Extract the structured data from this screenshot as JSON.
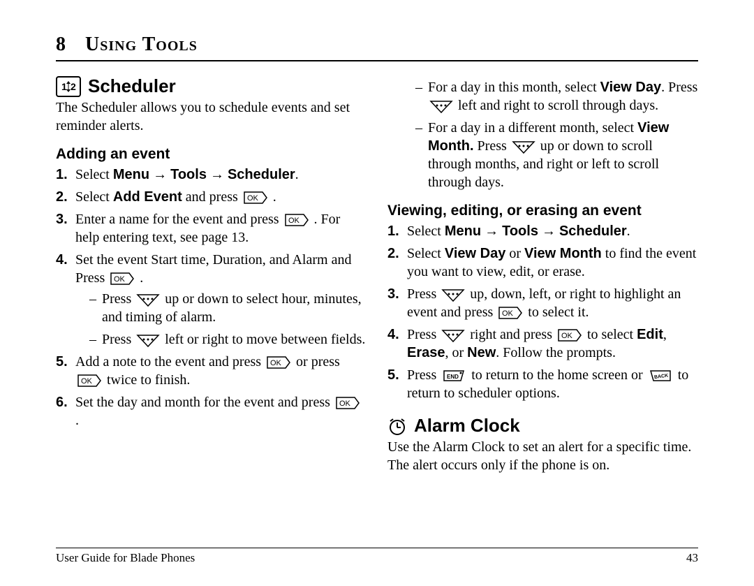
{
  "chapter": {
    "number": "8",
    "title": "Using Tools"
  },
  "col1": {
    "scheduler": {
      "heading": "Scheduler",
      "intro": "The Scheduler allows you to schedule events and set reminder alerts.",
      "adding": {
        "heading": "Adding an event",
        "step1_a": "Select ",
        "step1_menu": "Menu",
        "step1_arrow1": " → ",
        "step1_tools": "Tools",
        "step1_arrow2": " → ",
        "step1_sched": "Scheduler",
        "step1_end": ".",
        "step2_a": "Select ",
        "step2_b": "Add Event",
        "step2_c": " and press ",
        "step2_d": " .",
        "step3_a": "Enter a name for the event and press ",
        "step3_b": " . For help entering text, see page 13.",
        "step4_a": "Set the event Start time, Duration, and Alarm and Press ",
        "step4_b": " .",
        "step4_sub1_a": "Press ",
        "step4_sub1_b": " up or down to select hour, minutes, and timing of alarm.",
        "step4_sub2_a": "Press ",
        "step4_sub2_b": " left or right to move between fields.",
        "step5_a": "Add a note to the event and press ",
        "step5_b": "  or press ",
        "step5_c": " twice to finish.",
        "step6_a": "Set the day and month for the event and press ",
        "step6_b": " ."
      }
    }
  },
  "col2": {
    "cont": {
      "bullet1_a": "For a day in this month, select ",
      "bullet1_b": "View Day",
      "bullet1_c": ". Press ",
      "bullet1_d": " left and right to scroll through days.",
      "bullet2_a": "For a day in a different month, select ",
      "bullet2_b": "View Month.",
      "bullet2_c": " Press ",
      "bullet2_d": " up or down to scroll through months, and right or left to scroll through days."
    },
    "viewing": {
      "heading": "Viewing, editing, or erasing an event",
      "step1_a": "Select ",
      "step1_menu": "Menu",
      "step1_arrow1": " → ",
      "step1_tools": "Tools",
      "step1_arrow2": " → ",
      "step1_sched": "Scheduler",
      "step1_end": ".",
      "step2_a": "Select ",
      "step2_b": "View Day",
      "step2_c": " or ",
      "step2_d": "View Month",
      "step2_e": " to find the event you want to view, edit, or erase.",
      "step3_a": "Press ",
      "step3_b": " up, down, left, or right to highlight an event and press ",
      "step3_c": " to select it.",
      "step4_a": "Press ",
      "step4_b": " right and press ",
      "step4_c": " to select ",
      "step4_d": "Edit",
      "step4_e": ", ",
      "step4_f": "Erase",
      "step4_g": ", or ",
      "step4_h": "New",
      "step4_i": ". Follow the prompts.",
      "step5_a": "Press ",
      "step5_b": " to return to the home screen or ",
      "step5_c": " to return to scheduler options."
    },
    "alarm": {
      "heading": "Alarm Clock",
      "intro": "Use the Alarm Clock to set an alert for a specific time. The alert occurs only if the phone is on."
    }
  },
  "footer": {
    "left": "User Guide for Blade Phones",
    "right": "43"
  },
  "icons": {
    "calendar_label": "1 2"
  }
}
